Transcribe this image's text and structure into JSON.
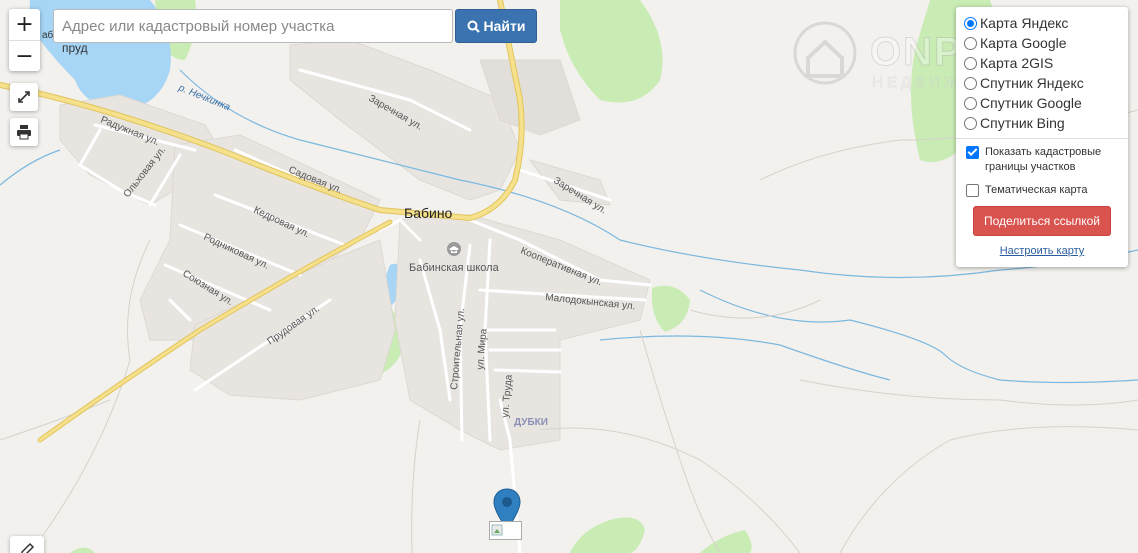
{
  "search": {
    "placeholder": "Адрес или кадастровый номер участка",
    "button_label": "Найти"
  },
  "zoom": {
    "in_label": "+",
    "out_label": "−"
  },
  "layers": {
    "options": [
      {
        "label": "Карта Яндекс",
        "selected": true
      },
      {
        "label": "Карта Google",
        "selected": false
      },
      {
        "label": "Карта 2GIS",
        "selected": false
      },
      {
        "label": "Спутник Яндекс",
        "selected": false
      },
      {
        "label": "Спутник Google",
        "selected": false
      },
      {
        "label": "Спутник Bing",
        "selected": false
      }
    ],
    "cadastral_label": "Показать кадастровые границы участков",
    "cadastral_checked": true,
    "thematic_label": "Тематическая карта",
    "thematic_checked": false,
    "share_label": "Поделиться ссылкой",
    "setup_label": "Настроить карту"
  },
  "watermark": {
    "brand": "ONPLOT",
    "sub": "НЕДВИЖИМОСТЬ"
  },
  "map_labels": {
    "town": "Бабино",
    "school": "Бабинская школа",
    "district": "ДУБКИ",
    "pond": "пруд",
    "pond_prefix": "аб",
    "river": "р. Нечкинка",
    "streets": {
      "raduzhnaya": "Радужная ул.",
      "olkhovaya": "Ольховая ул.",
      "sadovaya": "Садовая ул.",
      "kedrovaya": "Кедровая ул.",
      "rodnikovaya": "Родниковая ул.",
      "soyuznaya": "Союзная ул.",
      "prudovaya": "Прудовая ул.",
      "zarechnaya1": "Заречная ул.",
      "zarechnaya2": "Заречная ул.",
      "kooperativnaya": "Кооперативная ул.",
      "malodokynskaya": "Малодокынская ул.",
      "stroitelnaya": "Строительная ул.",
      "mira": "ул. Мира",
      "truda": "ул. Труда"
    }
  },
  "colors": {
    "land": "#f3f1ed",
    "settlement": "#e8e5e1",
    "forest": "#c9ecb5",
    "water": "#a6d5f5",
    "stream": "#7ab8e0",
    "main_road": "#f5e08b",
    "road_edge": "#e2c45e",
    "street": "#ffffff",
    "marker": "#2f7fc1",
    "search_button": "#3b73b0",
    "share_button": "#d9534f"
  }
}
